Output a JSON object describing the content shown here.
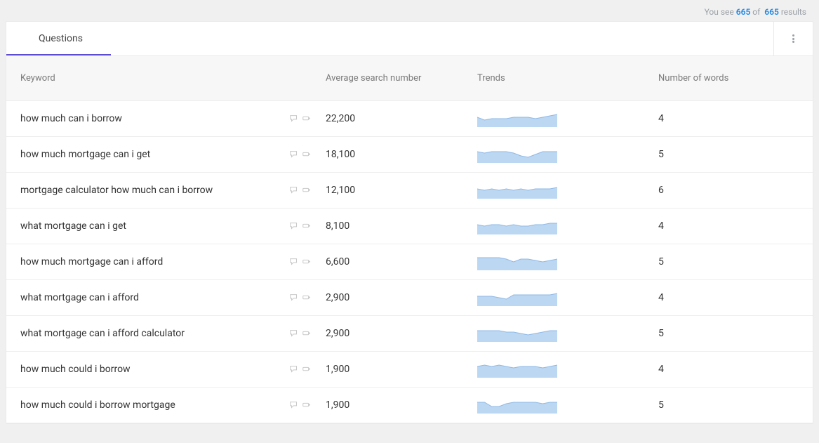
{
  "summary": {
    "prefix": "You see",
    "count_shown": "665",
    "of": "of",
    "count_total": "665",
    "suffix": "results"
  },
  "tabs": {
    "active_label": "Questions"
  },
  "columns": {
    "keyword": "Keyword",
    "avg": "Average search number",
    "trends": "Trends",
    "words": "Number of words"
  },
  "rows": [
    {
      "keyword": "how much can i borrow",
      "avg": "22,200",
      "words": "4",
      "spark": [
        7,
        5,
        6,
        6,
        6,
        7,
        7,
        7,
        6,
        7,
        8,
        9
      ]
    },
    {
      "keyword": "how much mortgage can i get",
      "avg": "18,100",
      "words": "5",
      "spark": [
        8,
        7,
        8,
        8,
        8,
        7,
        5,
        4,
        6,
        8,
        8,
        8
      ]
    },
    {
      "keyword": "mortgage calculator how much can i borrow",
      "avg": "12,100",
      "words": "6",
      "spark": [
        7,
        6,
        7,
        6,
        7,
        6,
        7,
        6,
        7,
        7,
        7,
        8
      ]
    },
    {
      "keyword": "what mortgage can i get",
      "avg": "8,100",
      "words": "4",
      "spark": [
        7,
        6,
        7,
        7,
        6,
        7,
        6,
        6,
        7,
        7,
        8,
        8
      ]
    },
    {
      "keyword": "how much mortgage can i afford",
      "avg": "6,600",
      "words": "5",
      "spark": [
        9,
        9,
        9,
        9,
        8,
        6,
        8,
        8,
        7,
        6,
        7,
        8
      ]
    },
    {
      "keyword": "what mortgage can i afford",
      "avg": "2,900",
      "words": "4",
      "spark": [
        7,
        7,
        7,
        6,
        5,
        8,
        8,
        8,
        8,
        8,
        8,
        9
      ]
    },
    {
      "keyword": "what mortgage can i afford calculator",
      "avg": "2,900",
      "words": "5",
      "spark": [
        8,
        8,
        8,
        8,
        7,
        7,
        6,
        5,
        6,
        7,
        8,
        8
      ]
    },
    {
      "keyword": "how much could i borrow",
      "avg": "1,900",
      "words": "4",
      "spark": [
        8,
        9,
        8,
        9,
        8,
        7,
        8,
        8,
        8,
        7,
        8,
        9
      ]
    },
    {
      "keyword": "how much could i borrow mortgage",
      "avg": "1,900",
      "words": "5",
      "spark": [
        8,
        8,
        5,
        5,
        7,
        8,
        8,
        8,
        8,
        7,
        8,
        8
      ]
    }
  ]
}
